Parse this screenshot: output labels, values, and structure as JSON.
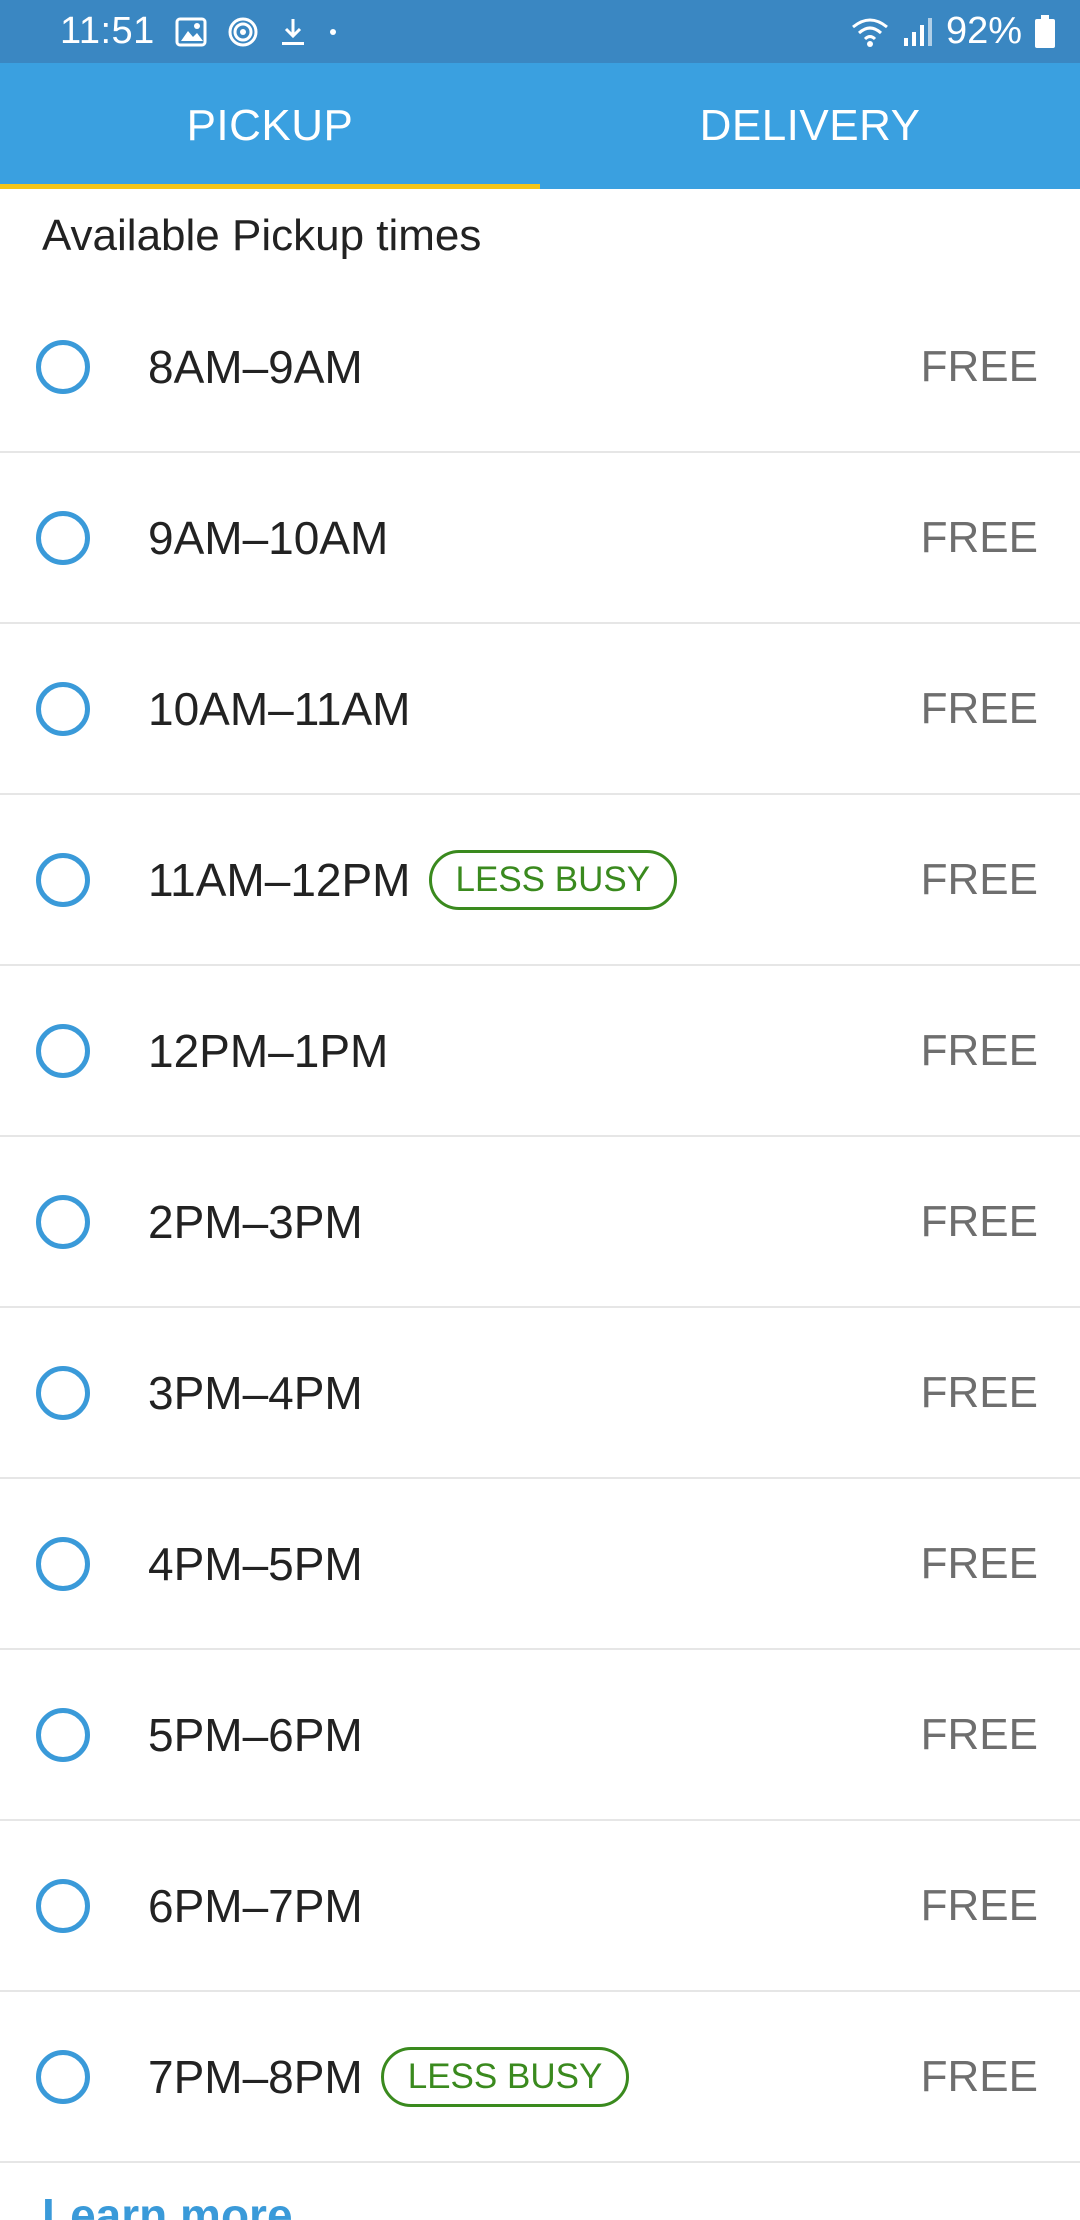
{
  "status_bar": {
    "time": "11:51",
    "battery": "92%",
    "icons": [
      "image-icon",
      "fingerprint-icon",
      "download-icon",
      "dot-icon",
      "wifi-icon",
      "signal-icon",
      "battery-icon"
    ]
  },
  "tabs": [
    {
      "label": "PICKUP",
      "active": true
    },
    {
      "label": "DELIVERY",
      "active": false
    }
  ],
  "section": {
    "title": "Available Pickup times"
  },
  "slots": [
    {
      "time": "8AM–9AM",
      "badge": "",
      "price": "FREE"
    },
    {
      "time": "9AM–10AM",
      "badge": "",
      "price": "FREE"
    },
    {
      "time": "10AM–11AM",
      "badge": "",
      "price": "FREE"
    },
    {
      "time": "11AM–12PM",
      "badge": "LESS BUSY",
      "price": "FREE"
    },
    {
      "time": "12PM–1PM",
      "badge": "",
      "price": "FREE"
    },
    {
      "time": "2PM–3PM",
      "badge": "",
      "price": "FREE"
    },
    {
      "time": "3PM–4PM",
      "badge": "",
      "price": "FREE"
    },
    {
      "time": "4PM–5PM",
      "badge": "",
      "price": "FREE"
    },
    {
      "time": "5PM–6PM",
      "badge": "",
      "price": "FREE"
    },
    {
      "time": "6PM–7PM",
      "badge": "",
      "price": "FREE"
    },
    {
      "time": "7PM–8PM",
      "badge": "LESS BUSY",
      "price": "FREE"
    }
  ],
  "footer": {
    "learn_more": "Learn more"
  },
  "colors": {
    "status_bar": "#3a87c2",
    "tab_bar": "#3aa0e0",
    "tab_indicator": "#f5c518",
    "radio": "#3a9ad9",
    "badge": "#3a8a1e",
    "price": "#6e6e6e"
  }
}
